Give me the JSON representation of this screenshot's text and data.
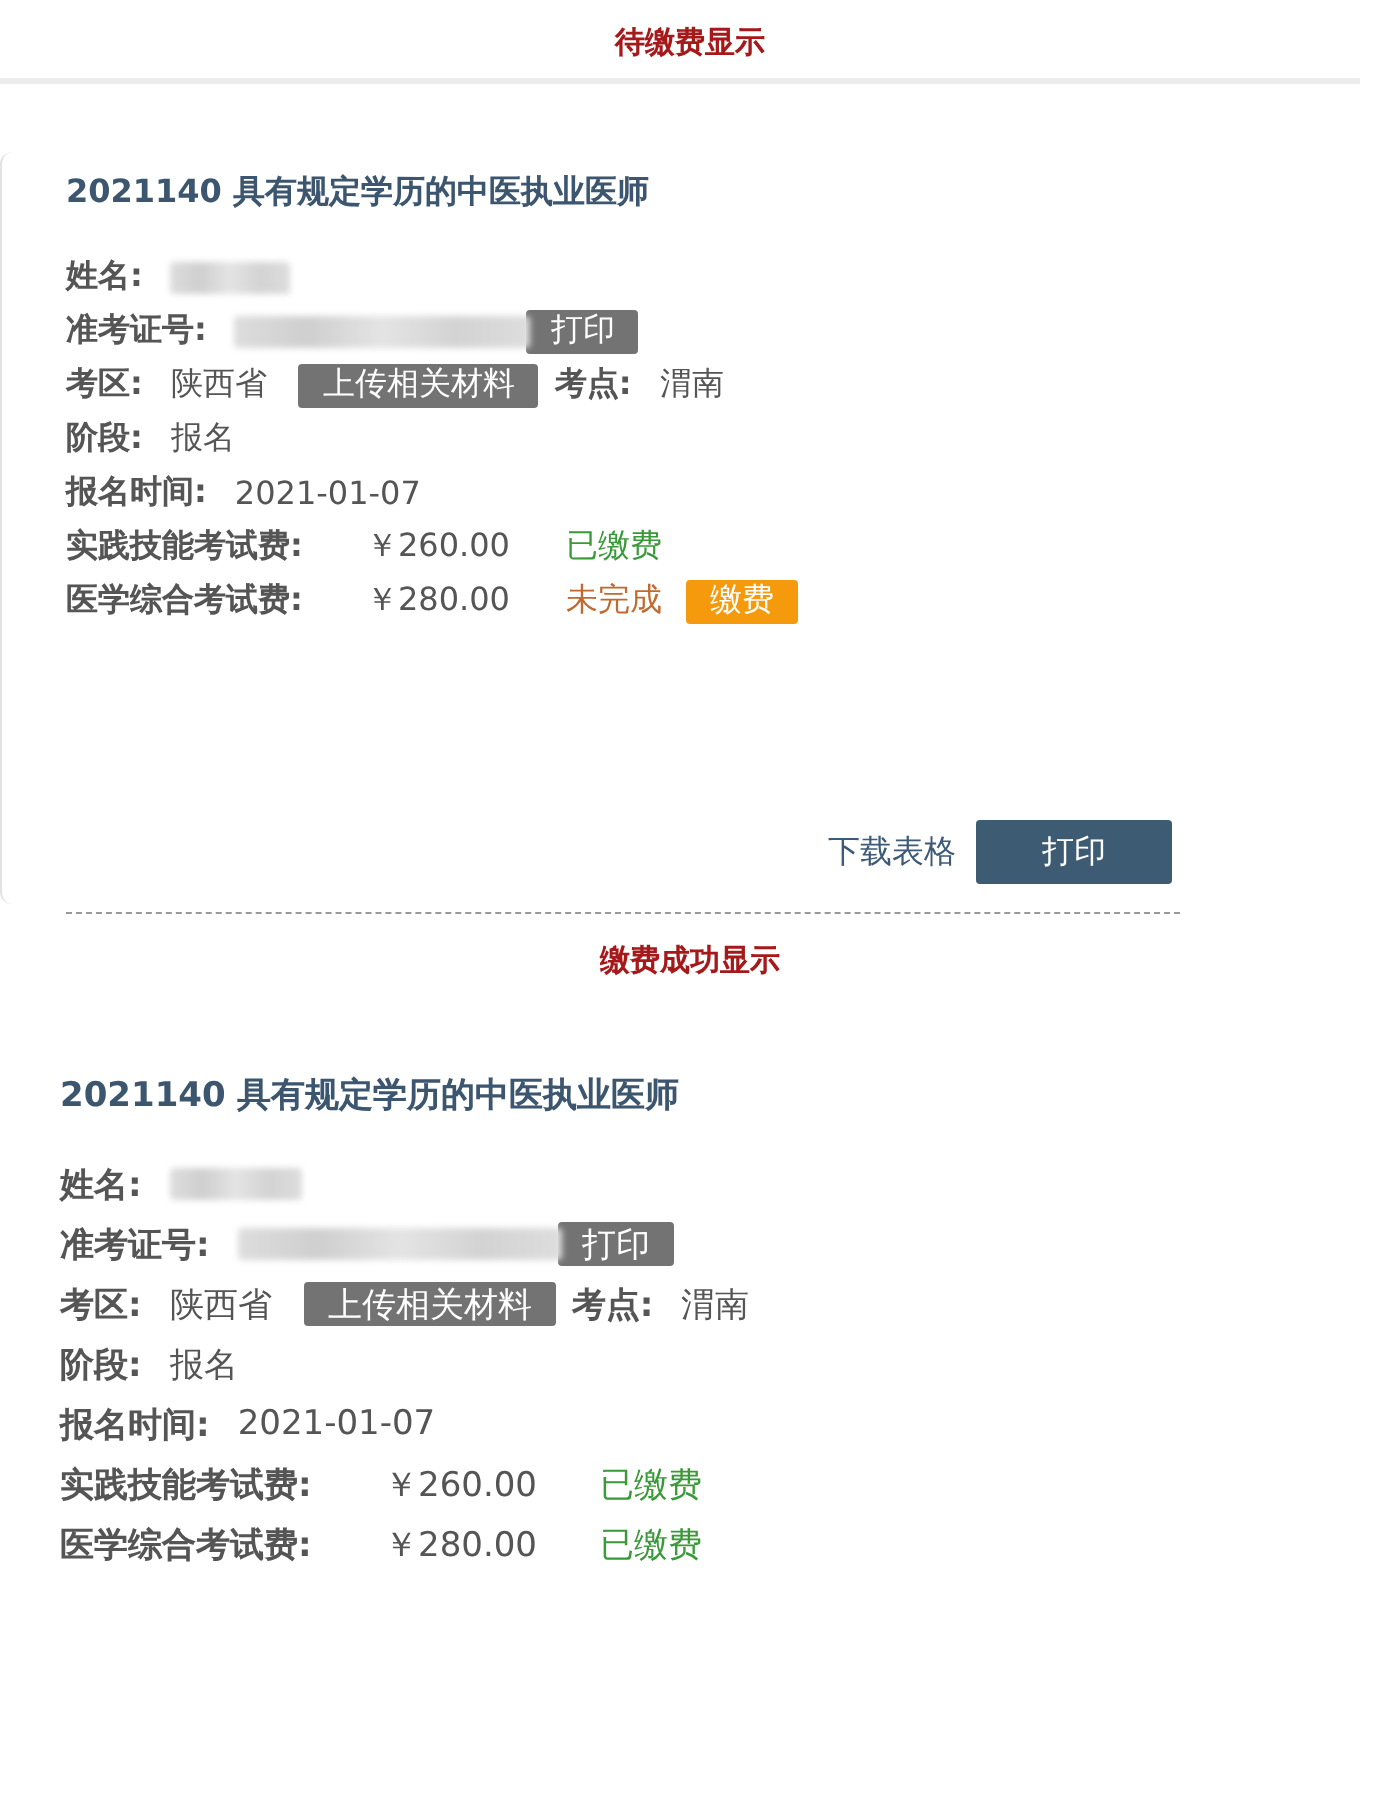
{
  "sections": [
    {
      "heading": "待缴费显示",
      "title": "2021140 具有规定学历的中医执业医师",
      "rows": [
        {
          "kind": "name",
          "label": "姓名:"
        },
        {
          "kind": "ticket",
          "label": "准考证号:",
          "button": "打印"
        },
        {
          "kind": "region",
          "label": "考区:",
          "value": "陕西省",
          "button": "上传相关材料",
          "label2": "考点:",
          "value2": "渭南"
        },
        {
          "kind": "text",
          "label": "阶段:",
          "value": "报名"
        },
        {
          "kind": "text",
          "label": "报名时间:",
          "value": "2021-01-07"
        },
        {
          "kind": "fee",
          "label": "实践技能考试费:",
          "amount": "￥260.00",
          "status": "已缴费",
          "paid": true
        },
        {
          "kind": "fee",
          "label": "医学综合考试费:",
          "amount": "￥280.00",
          "status": "未完成",
          "paid": false,
          "action": "缴费"
        }
      ],
      "footer": {
        "link": "下载表格",
        "button": "打印"
      }
    },
    {
      "heading": "缴费成功显示",
      "title": "2021140 具有规定学历的中医执业医师",
      "rows": [
        {
          "kind": "name",
          "label": "姓名:"
        },
        {
          "kind": "ticket",
          "label": "准考证号:",
          "button": "打印"
        },
        {
          "kind": "region",
          "label": "考区:",
          "value": "陕西省",
          "button": "上传相关材料",
          "label2": "考点:",
          "value2": "渭南"
        },
        {
          "kind": "text",
          "label": "阶段:",
          "value": "报名"
        },
        {
          "kind": "text",
          "label": "报名时间:",
          "value": "2021-01-07"
        },
        {
          "kind": "fee",
          "label": "实践技能考试费:",
          "amount": "￥260.00",
          "status": "已缴费",
          "paid": true
        },
        {
          "kind": "fee",
          "label": "医学综合考试费:",
          "amount": "￥280.00",
          "status": "已缴费",
          "paid": true
        }
      ]
    }
  ]
}
